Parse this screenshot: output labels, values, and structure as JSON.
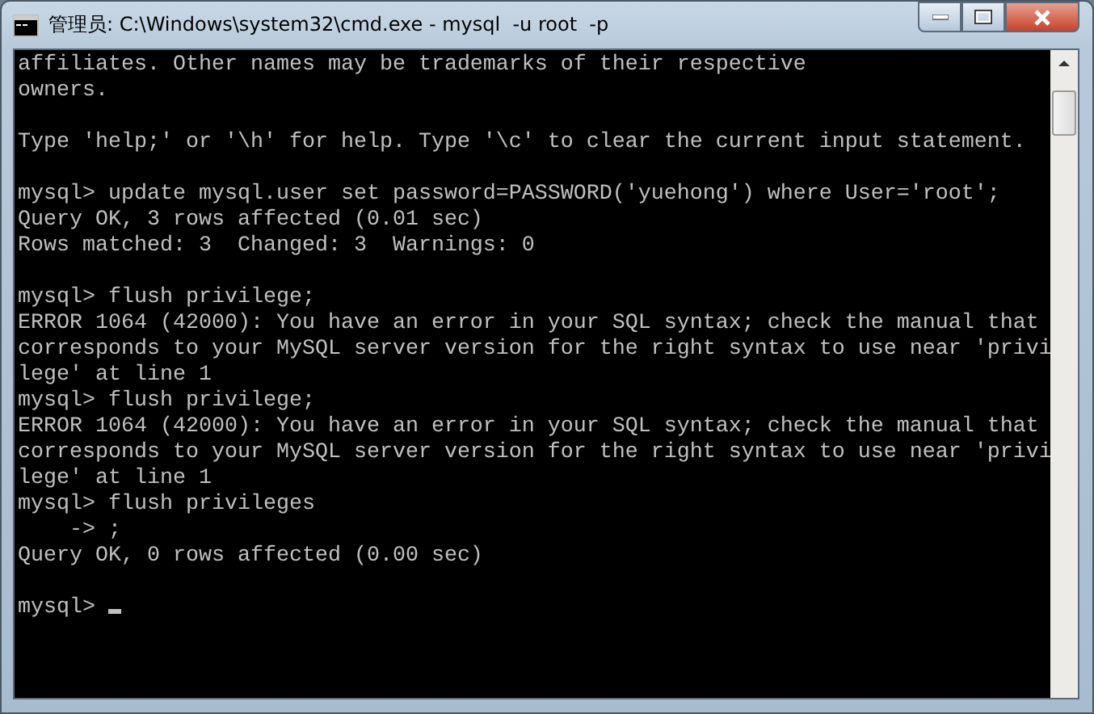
{
  "window": {
    "title": "管理员: C:\\Windows\\system32\\cmd.exe - mysql  -u root  -p"
  },
  "console": {
    "lines": [
      {
        "kind": "text",
        "text": "affiliates. Other names may be trademarks of their respective"
      },
      {
        "kind": "text",
        "text": "owners."
      },
      {
        "kind": "blank"
      },
      {
        "kind": "text",
        "text": "Type 'help;' or '\\h' for help. Type '\\c' to clear the current input statement."
      },
      {
        "kind": "blank"
      },
      {
        "kind": "text",
        "text": "mysql> update mysql.user set password=PASSWORD('yuehong') where User='root';"
      },
      {
        "kind": "text",
        "text": "Query OK, 3 rows affected (0.01 sec)"
      },
      {
        "kind": "text",
        "text": "Rows matched: 3  Changed: 3  Warnings: 0"
      },
      {
        "kind": "blank"
      },
      {
        "kind": "text",
        "text": "mysql> flush privilege;"
      },
      {
        "kind": "text",
        "text": "ERROR 1064 (42000): You have an error in your SQL syntax; check the manual that"
      },
      {
        "kind": "text",
        "text": "corresponds to your MySQL server version for the right syntax to use near 'privi"
      },
      {
        "kind": "text",
        "text": "lege' at line 1"
      },
      {
        "kind": "text",
        "text": "mysql> flush privilege;"
      },
      {
        "kind": "text",
        "text": "ERROR 1064 (42000): You have an error in your SQL syntax; check the manual that"
      },
      {
        "kind": "text",
        "text": "corresponds to your MySQL server version for the right syntax to use near 'privi"
      },
      {
        "kind": "text",
        "text": "lege' at line 1"
      },
      {
        "kind": "text",
        "text": "mysql> flush privileges"
      },
      {
        "kind": "text",
        "text": "    -> ;"
      },
      {
        "kind": "text",
        "text": "Query OK, 0 rows affected (0.00 sec)"
      },
      {
        "kind": "blank"
      },
      {
        "kind": "prompt",
        "text": "mysql>",
        "cursor": true
      }
    ]
  }
}
